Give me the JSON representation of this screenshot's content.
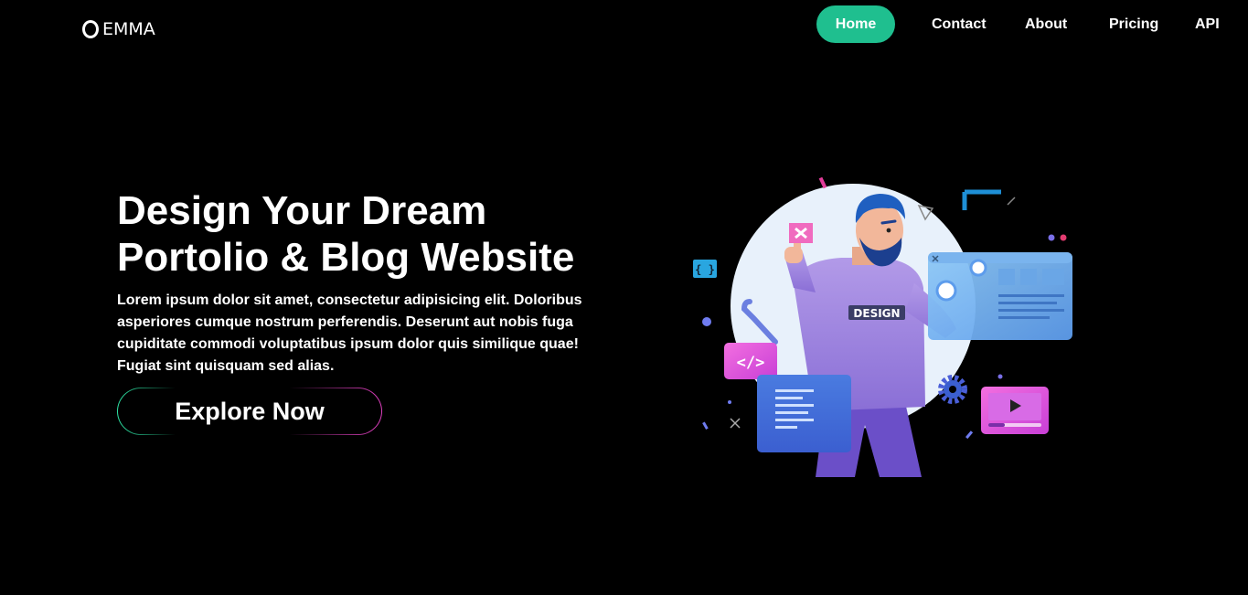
{
  "brand": {
    "name": "EMMA"
  },
  "nav": {
    "items": [
      {
        "label": "Home",
        "active": true
      },
      {
        "label": "Contact"
      },
      {
        "label": "About"
      },
      {
        "label": "Pricing"
      },
      {
        "label": "API"
      }
    ]
  },
  "hero": {
    "title_line1": "Design Your Dream",
    "title_line2": "Portolio & Blog Website",
    "description": "Lorem ipsum dolor sit amet, consectetur adipisicing elit. Doloribus asperiores cumque nostrum perferendis. Deserunt aut nobis fuga cupiditate commodi voluptatibus ipsum dolor quis similique quae! Fugiat sint quisquam sed alias.",
    "cta_label": "Explore Now"
  },
  "illustration": {
    "shirt_text": "DESIGN",
    "code_badge": "</>"
  },
  "colors": {
    "accent": "#1fbf8f",
    "background": "#000000",
    "cta_gradient_start": "#2ee6a6",
    "cta_gradient_end": "#e040c0"
  }
}
